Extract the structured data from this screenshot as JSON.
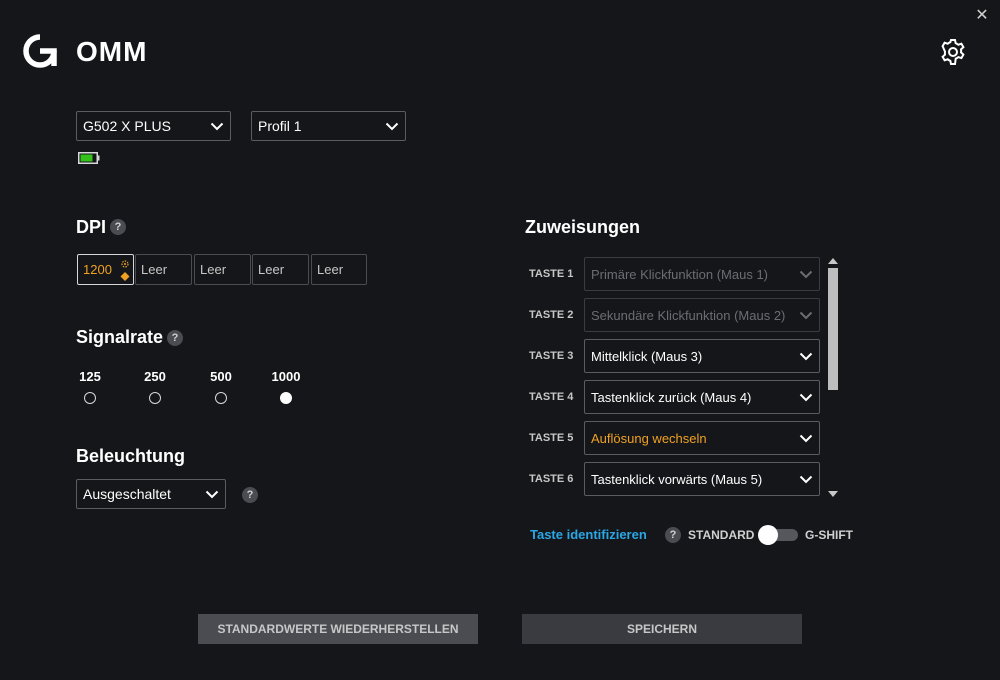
{
  "app": {
    "title": "OMM",
    "close_label": "✕"
  },
  "device": {
    "selected": "G502 X PLUS"
  },
  "profile": {
    "selected": "Profil 1"
  },
  "dpi": {
    "title": "DPI",
    "help": "?",
    "slots": [
      {
        "label": "1200",
        "active": true
      },
      {
        "label": "Leer",
        "active": false
      },
      {
        "label": "Leer",
        "active": false
      },
      {
        "label": "Leer",
        "active": false
      },
      {
        "label": "Leer",
        "active": false
      }
    ]
  },
  "signalrate": {
    "title": "Signalrate",
    "help": "?",
    "options": [
      {
        "label": "125",
        "selected": false
      },
      {
        "label": "250",
        "selected": false
      },
      {
        "label": "500",
        "selected": false
      },
      {
        "label": "1000",
        "selected": true
      }
    ]
  },
  "lighting": {
    "title": "Beleuchtung",
    "selected": "Ausgeschaltet",
    "help": "?"
  },
  "assignments": {
    "title": "Zuweisungen",
    "rows": [
      {
        "key": "TASTE 1",
        "value": "Primäre Klickfunktion (Maus 1)",
        "state": "disabled"
      },
      {
        "key": "TASTE 2",
        "value": "Sekundäre Klickfunktion (Maus 2)",
        "state": "disabled"
      },
      {
        "key": "TASTE 3",
        "value": "Mittelklick (Maus 3)",
        "state": "normal"
      },
      {
        "key": "TASTE 4",
        "value": "Tastenklick zurück (Maus 4)",
        "state": "normal"
      },
      {
        "key": "TASTE 5",
        "value": "Auflösung wechseln",
        "state": "accent"
      },
      {
        "key": "TASTE 6",
        "value": "Tastenklick vorwärts (Maus 5)",
        "state": "normal"
      }
    ],
    "identify_link": "Taste identifizieren",
    "help": "?",
    "standard_label": "STANDARD",
    "gshift_label": "G-SHIFT"
  },
  "buttons": {
    "reset": "STANDARDWERTE WIEDERHERSTELLEN",
    "save": "SPEICHERN"
  },
  "colors": {
    "background": "#151619",
    "accent_orange": "#f0a124",
    "link_blue": "#2aa6e6",
    "battery_green": "#34c21a"
  },
  "icons": {
    "logo": "g-logo-icon",
    "settings": "gear-icon",
    "close": "close-icon",
    "chevron": "chevron-down-icon",
    "battery": "battery-icon"
  }
}
